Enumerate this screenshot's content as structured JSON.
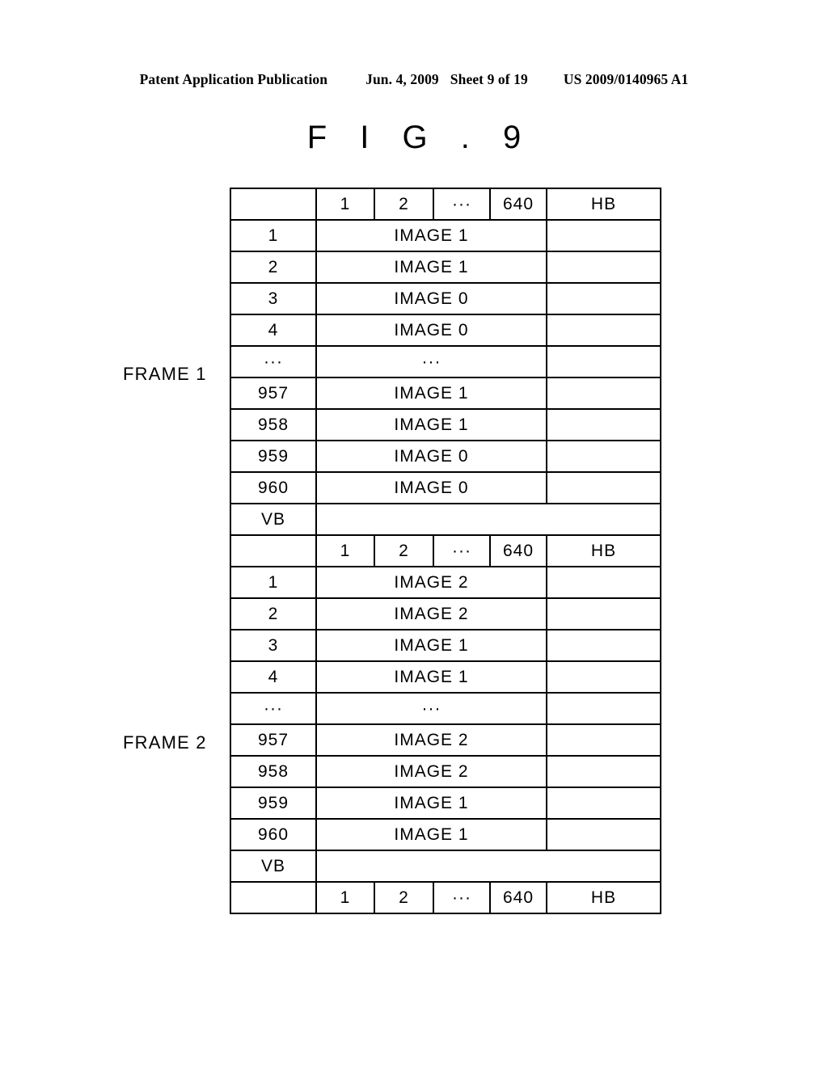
{
  "patent_header": {
    "publication": "Patent Application Publication",
    "date": "Jun. 4, 2009",
    "sheet": "Sheet 9 of 19",
    "number": "US 2009/0140965 A1"
  },
  "figure": {
    "title": "F I G . 9"
  },
  "side_labels": {
    "frame1": "FRAME 1",
    "frame2": "FRAME 2"
  },
  "column_header": {
    "blank": "",
    "col1": "1",
    "col2": "2",
    "col_ellipsis": "···",
    "col640": "640",
    "col_hb": "HB"
  },
  "labels": {
    "vb": "VB",
    "ellipsis": "···"
  },
  "chart_data": {
    "type": "table",
    "title": "F I G . 9",
    "description": "Frame timing / line buffer map showing per-line image assignment with horizontal blanking (HB) and vertical blanking (VB) regions",
    "columns": [
      "",
      "1",
      "2",
      "···",
      "640",
      "HB"
    ],
    "sections": [
      {
        "label": "FRAME 1",
        "header": [
          "",
          "1",
          "2",
          "···",
          "640",
          "HB"
        ],
        "rows": [
          {
            "index": "1",
            "image": "IMAGE 1",
            "hb": "stipple"
          },
          {
            "index": "2",
            "image": "IMAGE 1",
            "hb": "stipple"
          },
          {
            "index": "3",
            "image": "IMAGE 0",
            "hb": "stipple"
          },
          {
            "index": "4",
            "image": "IMAGE 0",
            "hb": "stipple"
          },
          {
            "index": "···",
            "image": "···",
            "hb": "stipple"
          },
          {
            "index": "957",
            "image": "IMAGE 1",
            "hb": "stipple"
          },
          {
            "index": "958",
            "image": "IMAGE 1",
            "hb": "stipple"
          },
          {
            "index": "959",
            "image": "IMAGE 0",
            "hb": "stipple"
          },
          {
            "index": "960",
            "image": "IMAGE 0",
            "hb": "stipple"
          }
        ],
        "vb_row": {
          "index": "VB",
          "fill": "stipple"
        }
      },
      {
        "label": "FRAME 2",
        "header": [
          "",
          "1",
          "2",
          "···",
          "640",
          "HB"
        ],
        "rows": [
          {
            "index": "1",
            "image": "IMAGE 2",
            "hb": "stipple"
          },
          {
            "index": "2",
            "image": "IMAGE 2",
            "hb": "stipple"
          },
          {
            "index": "3",
            "image": "IMAGE 1",
            "hb": "stipple"
          },
          {
            "index": "4",
            "image": "IMAGE 1",
            "hb": "stipple"
          },
          {
            "index": "···",
            "image": "···",
            "hb": "stipple"
          },
          {
            "index": "957",
            "image": "IMAGE 2",
            "hb": "stipple"
          },
          {
            "index": "958",
            "image": "IMAGE 2",
            "hb": "stipple"
          },
          {
            "index": "959",
            "image": "IMAGE 1",
            "hb": "stipple"
          },
          {
            "index": "960",
            "image": "IMAGE 1",
            "hb": "stipple"
          }
        ],
        "vb_row": {
          "index": "VB",
          "fill": "stipple"
        }
      }
    ],
    "footer_header": [
      "",
      "1",
      "2",
      "···",
      "640",
      "HB"
    ]
  }
}
